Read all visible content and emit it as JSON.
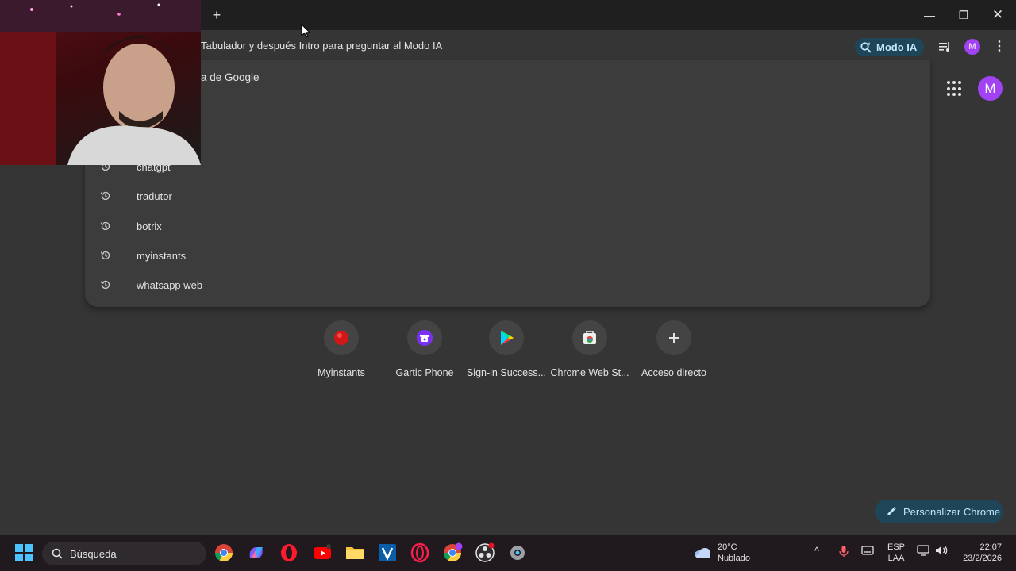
{
  "window": {
    "new_tab_label": "+",
    "minimize": "—",
    "maximize": "❐",
    "close": "✕"
  },
  "omnibox": {
    "hint": "Tabulador y después Intro para preguntar al Modo IA",
    "modo_ia_label": "Modo IA",
    "avatar_letter": "M",
    "menu": "⋮"
  },
  "suggestions": {
    "top_partial": "a de Google",
    "history": [
      {
        "label": "chatgpt",
        "icon": "history-icon"
      },
      {
        "label": "tradutor",
        "icon": "history-icon"
      },
      {
        "label": "botrix",
        "icon": "history-icon"
      },
      {
        "label": "myinstants",
        "icon": "history-icon"
      },
      {
        "label": "whatsapp web",
        "icon": "history-icon"
      }
    ]
  },
  "ntp": {
    "avatar_letter": "M",
    "shortcuts": [
      {
        "label": "Myinstants",
        "icon": "red-circle-icon"
      },
      {
        "label": "Gartic Phone",
        "icon": "phone-icon"
      },
      {
        "label": "Sign-in Success...",
        "icon": "play-store-icon"
      },
      {
        "label": "Chrome Web St...",
        "icon": "web-store-icon"
      },
      {
        "label": "Acceso directo",
        "icon": "plus-icon"
      }
    ],
    "customize_label": "Personalizar Chrome"
  },
  "taskbar": {
    "search_placeholder": "Búsqueda",
    "weather_temp": "20°C",
    "weather_desc": "Nublado",
    "lang_top": "ESP",
    "lang_bottom": "LAA",
    "time": "22:07",
    "date": "23/2/2026"
  },
  "colors": {
    "accent": "#1e4658",
    "accent_text": "#c2e7ff",
    "avatar": "#a142f4"
  }
}
